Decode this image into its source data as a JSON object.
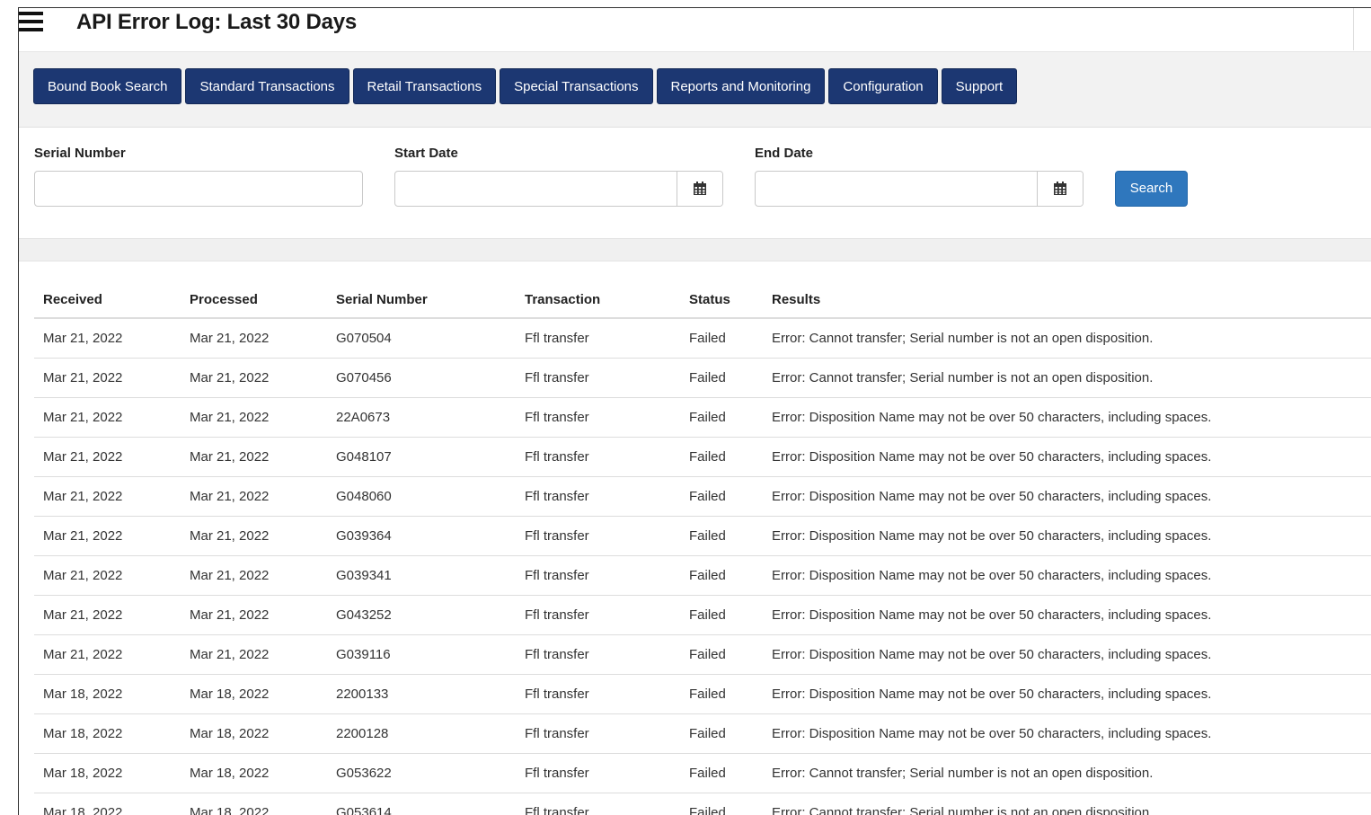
{
  "header": {
    "title": "API Error Log: Last 30 Days",
    "menu_icon": "hamburger-menu-icon"
  },
  "nav": {
    "items": [
      {
        "label": "Bound Book Search"
      },
      {
        "label": "Standard Transactions"
      },
      {
        "label": "Retail Transactions"
      },
      {
        "label": "Special Transactions"
      },
      {
        "label": "Reports and Monitoring"
      },
      {
        "label": "Configuration"
      },
      {
        "label": "Support"
      }
    ]
  },
  "filters": {
    "serial_label": "Serial Number",
    "serial_value": "",
    "start_label": "Start Date",
    "start_value": "",
    "end_label": "End Date",
    "end_value": "",
    "calendar_icon": "calendar-icon",
    "search_label": "Search"
  },
  "table": {
    "columns": [
      "Received",
      "Processed",
      "Serial Number",
      "Transaction",
      "Status",
      "Results"
    ],
    "rows": [
      [
        "Mar 21, 2022",
        "Mar 21, 2022",
        "G070504",
        "Ffl transfer",
        "Failed",
        "Error: Cannot transfer; Serial number is not an open disposition."
      ],
      [
        "Mar 21, 2022",
        "Mar 21, 2022",
        "G070456",
        "Ffl transfer",
        "Failed",
        "Error: Cannot transfer; Serial number is not an open disposition."
      ],
      [
        "Mar 21, 2022",
        "Mar 21, 2022",
        "22A0673",
        "Ffl transfer",
        "Failed",
        "Error: Disposition Name may not be over 50 characters, including spaces."
      ],
      [
        "Mar 21, 2022",
        "Mar 21, 2022",
        "G048107",
        "Ffl transfer",
        "Failed",
        "Error: Disposition Name may not be over 50 characters, including spaces."
      ],
      [
        "Mar 21, 2022",
        "Mar 21, 2022",
        "G048060",
        "Ffl transfer",
        "Failed",
        "Error: Disposition Name may not be over 50 characters, including spaces."
      ],
      [
        "Mar 21, 2022",
        "Mar 21, 2022",
        "G039364",
        "Ffl transfer",
        "Failed",
        "Error: Disposition Name may not be over 50 characters, including spaces."
      ],
      [
        "Mar 21, 2022",
        "Mar 21, 2022",
        "G039341",
        "Ffl transfer",
        "Failed",
        "Error: Disposition Name may not be over 50 characters, including spaces."
      ],
      [
        "Mar 21, 2022",
        "Mar 21, 2022",
        "G043252",
        "Ffl transfer",
        "Failed",
        "Error: Disposition Name may not be over 50 characters, including spaces."
      ],
      [
        "Mar 21, 2022",
        "Mar 21, 2022",
        "G039116",
        "Ffl transfer",
        "Failed",
        "Error: Disposition Name may not be over 50 characters, including spaces."
      ],
      [
        "Mar 18, 2022",
        "Mar 18, 2022",
        "2200133",
        "Ffl transfer",
        "Failed",
        "Error: Disposition Name may not be over 50 characters, including spaces."
      ],
      [
        "Mar 18, 2022",
        "Mar 18, 2022",
        "2200128",
        "Ffl transfer",
        "Failed",
        "Error: Disposition Name may not be over 50 characters, including spaces."
      ],
      [
        "Mar 18, 2022",
        "Mar 18, 2022",
        "G053622",
        "Ffl transfer",
        "Failed",
        "Error: Cannot transfer; Serial number is not an open disposition."
      ],
      [
        "Mar 18, 2022",
        "Mar 18, 2022",
        "G053614",
        "Ffl transfer",
        "Failed",
        "Error: Cannot transfer; Serial number is not an open disposition."
      ]
    ]
  },
  "colors": {
    "nav_button": "#1c3772",
    "search_button": "#2f77bd",
    "band": "#f2f2f2"
  }
}
